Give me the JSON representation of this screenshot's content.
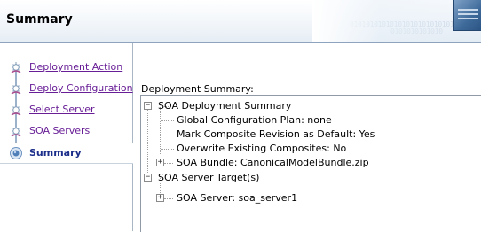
{
  "header": {
    "title": "Summary",
    "binary_line1": "0101010101010101010101010101",
    "binary_line2": "0101010101010"
  },
  "nav": {
    "items": [
      {
        "label": "Deployment Action",
        "state": "visited"
      },
      {
        "label": "Deploy Configuration",
        "state": "visited"
      },
      {
        "label": "Select Server",
        "state": "visited"
      },
      {
        "label": "SOA Servers",
        "state": "visited"
      },
      {
        "label": "Summary",
        "state": "current"
      }
    ]
  },
  "main": {
    "section_label": "Deployment Summary:",
    "tree": {
      "root1": {
        "label": "SOA Deployment Summary",
        "children": {
          "global_plan": "Global Configuration Plan: none",
          "mark_default": "Mark Composite Revision as Default: Yes",
          "overwrite": "Overwrite Existing Composites: No",
          "bundle": "SOA Bundle: CanonicalModelBundle.zip"
        }
      },
      "root2": {
        "label": "SOA Server Target(s)",
        "children": {
          "server": "SOA Server: soa_server1"
        }
      }
    }
  },
  "colors": {
    "visited_link": "#681e96",
    "current_step": "#1b2e8a",
    "header_border": "#8ea3bd"
  }
}
